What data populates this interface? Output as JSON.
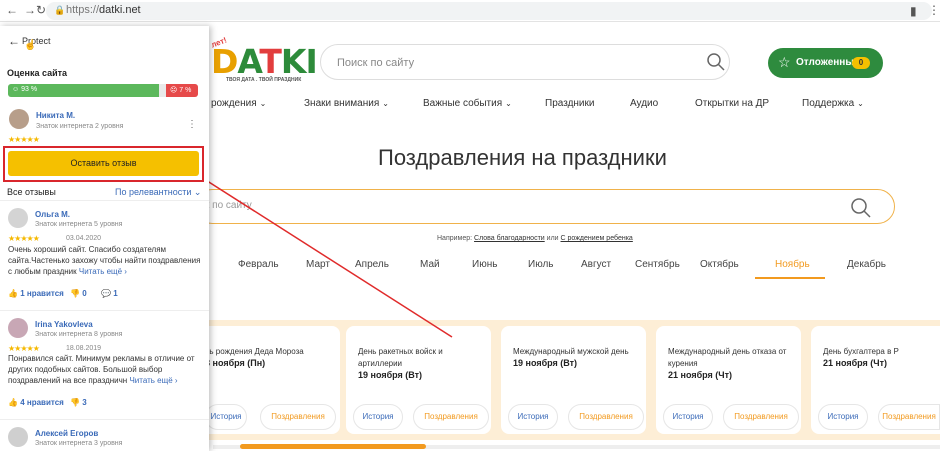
{
  "browser": {
    "url_protocol": "https://",
    "url_host": "datki.net"
  },
  "site": {
    "logo_letters": [
      "D",
      "A",
      "T",
      "KI"
    ],
    "logo_leaf": "лет!",
    "logo_tagline": "ТВОЯ ДАТА . ТВОЙ ПРАЗДНИК",
    "search_placeholder": "Поиск по сайту",
    "saved_label": "Отложенные",
    "saved_count": "0",
    "nav": [
      "рождения",
      "Знаки внимания",
      "Важные события",
      "Праздники",
      "Аудио",
      "Открытки на ДР",
      "Поддержка"
    ],
    "heading": "Поздравления на праздники",
    "main_search_placeholder": "к по сайту",
    "hint_prefix": "Например:",
    "hint_link1": "Слова благодарности",
    "hint_or": "или",
    "hint_link2": "С рождением ребенка",
    "months": [
      "Февраль",
      "Март",
      "Апрель",
      "Май",
      "Июнь",
      "Июль",
      "Август",
      "Сентябрь",
      "Октябрь",
      "Ноябрь",
      "Декабрь"
    ],
    "active_month": "Ноябрь",
    "cards": [
      {
        "title": "нь рождения Деда Мороза",
        "date": "8 ноября (Пн)"
      },
      {
        "title": "День ракетных войск и артиллерии",
        "date": "19 ноября (Вт)"
      },
      {
        "title": "Международный мужской день",
        "date": "19 ноября (Вт)"
      },
      {
        "title": "Международный день отказа от курения",
        "date": "21 ноября (Чт)"
      },
      {
        "title": "День бухгалтера в Р",
        "date": "21 ноября (Чт)"
      }
    ],
    "btn_history": "История",
    "btn_congrats": "Поздравления"
  },
  "panel": {
    "title": "Protect",
    "section": "Оценка сайта",
    "good_pct": "93 %",
    "bad_pct": "7 %",
    "good_fraction": 0.93,
    "user": {
      "name": "Никита М.",
      "level": "Знаток интернета 2 уровня",
      "stars": "★★★★★"
    },
    "leave_review": "Оставить отзыв",
    "all_reviews": "Все отзывы",
    "sort": "По релевантности",
    "reviews": [
      {
        "name": "Ольга М.",
        "level": "Знаток интернета 5 уровня",
        "stars": "★★★★★",
        "date": "03.04.2020",
        "text": "Очень хороший сайт. Спасибо создателям сайта.Частенько захожу чтобы найти поздравления с любым праздник",
        "more": "Читать ещё",
        "likes": "1 нравится",
        "dislikes": "0",
        "comments": "1"
      },
      {
        "name": "Irina Yakovleva",
        "level": "Знаток интернета 8 уровня",
        "stars": "★★★★★",
        "date": "18.08.2019",
        "text": "Понравился сайт. Минимум рекламы в отличие от других подобных сайтов. Большой выбор поздравлений на все праздничн",
        "more": "Читать ещё",
        "likes": "4 нравится",
        "dislikes": "3"
      },
      {
        "name": "Алексей Егоров",
        "level": "Знаток интернета 3 уровня"
      }
    ]
  }
}
